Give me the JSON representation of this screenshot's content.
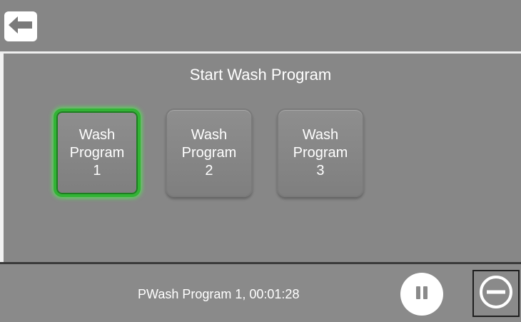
{
  "header": {
    "back_icon": "arrow-left-icon"
  },
  "main": {
    "title": "Start Wash Program",
    "programs": [
      {
        "label": "Wash\nProgram\n1",
        "selected": true
      },
      {
        "label": "Wash\nProgram\n2",
        "selected": false
      },
      {
        "label": "Wash\nProgram\n3",
        "selected": false
      }
    ]
  },
  "footer": {
    "status": "PWash Program 1, 00:01:28",
    "pause_icon": "pause-icon",
    "stop_icon": "minus-circle-icon"
  },
  "colors": {
    "accent_selected": "#32b335",
    "background": "#8a8a8a"
  }
}
